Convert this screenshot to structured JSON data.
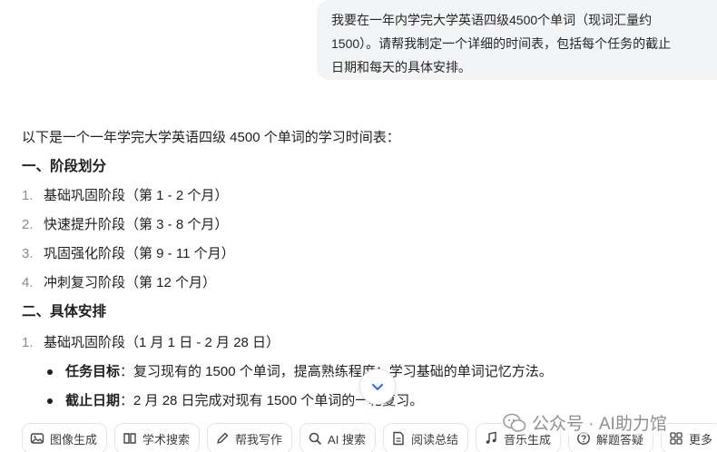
{
  "user_message": {
    "lines": [
      "我要在一年内学完大学英语四级4500个单词（现词汇量约",
      "1500）。请帮我制定一个详细的时间表，包括每个任务的截止",
      "日期和每天的具体安排。"
    ]
  },
  "answer": {
    "intro": "以下是一个一年学完大学英语四级 4500 个单词的学习时间表：",
    "section1_title": "一、阶段划分",
    "stages": [
      {
        "num": "1.",
        "text": "基础巩固阶段（第 1 - 2 个月）"
      },
      {
        "num": "2.",
        "text": "快速提升阶段（第 3 - 8 个月）"
      },
      {
        "num": "3.",
        "text": "巩固强化阶段（第 9 - 11 个月）"
      },
      {
        "num": "4.",
        "text": "冲刺复习阶段（第 12 个月）"
      }
    ],
    "section2_title": "二、具体安排",
    "plan_item": {
      "num": "1.",
      "text": "基础巩固阶段（1 月 1 日 - 2 月 28 日）"
    },
    "details": [
      {
        "label": "任务目标",
        "text": "：复习现有的 1500 个单词，提高熟练程度；学习基础的单词记忆方法。"
      },
      {
        "label": "截止日期",
        "text": "：2 月 28 日完成对现有 1500 个单词的一轮复习。"
      }
    ]
  },
  "toolbar": {
    "items": [
      {
        "label": "图像生成",
        "icon": "image-icon"
      },
      {
        "label": "学术搜索",
        "icon": "book-icon"
      },
      {
        "label": "帮我写作",
        "icon": "pen-icon"
      },
      {
        "label": "AI 搜索",
        "icon": "search-icon"
      },
      {
        "label": "阅读总结",
        "icon": "document-icon"
      },
      {
        "label": "音乐生成",
        "icon": "music-icon"
      },
      {
        "label": "解题答疑",
        "icon": "question-icon"
      },
      {
        "label": "更多",
        "icon": "grid-icon"
      }
    ]
  },
  "watermark": {
    "text": "公众号 · AI助力馆"
  },
  "colors": {
    "accent": "#3d6bff",
    "bubble": "#f3f4f6",
    "muted": "#8a8a8a"
  }
}
